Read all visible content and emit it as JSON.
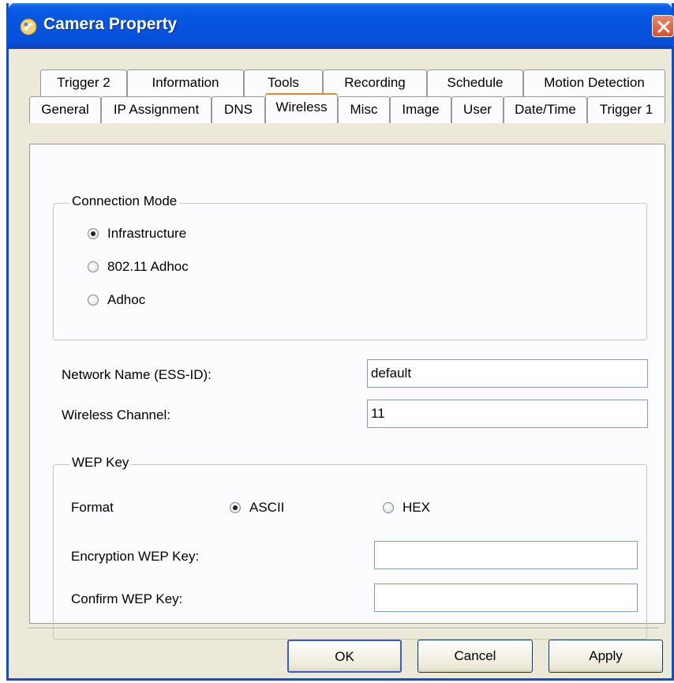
{
  "window": {
    "title": "Camera Property"
  },
  "tabs_row1": [
    "Trigger 2",
    "Information",
    "Tools",
    "Recording",
    "Schedule",
    "Motion Detection"
  ],
  "tabs_row2": [
    "General",
    "IP Assignment",
    "DNS",
    "Wireless",
    "Misc",
    "Image",
    "User",
    "Date/Time",
    "Trigger 1"
  ],
  "active_tab": "Wireless",
  "connection_mode": {
    "legend": "Connection Mode",
    "options": [
      "Infrastructure",
      "802.11 Adhoc",
      "Adhoc"
    ],
    "selected": "Infrastructure"
  },
  "network_name": {
    "label": "Network Name (ESS-ID):",
    "value": "default"
  },
  "wireless_channel": {
    "label": "Wireless Channel:",
    "value": "11"
  },
  "wep": {
    "legend": "WEP Key",
    "format_label": "Format",
    "format_options": [
      "ASCII",
      "HEX"
    ],
    "format_selected": "ASCII",
    "encryption_label": "Encryption WEP Key:",
    "encryption_value": "",
    "confirm_label": "Confirm WEP Key:",
    "confirm_value": ""
  },
  "buttons": {
    "ok": "OK",
    "cancel": "Cancel",
    "apply": "Apply"
  }
}
